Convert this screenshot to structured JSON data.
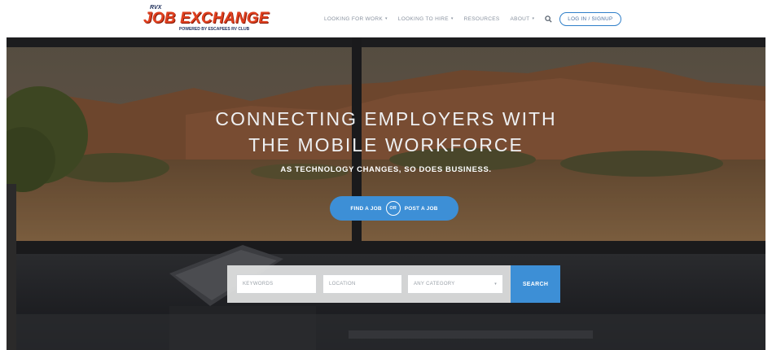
{
  "header": {
    "logo": {
      "top_mark": "RVX",
      "brand": "JOB EXCHANGE",
      "powered_by": "POWERED BY ESCAPEES RV CLUB"
    },
    "nav": [
      {
        "label": "LOOKING FOR WORK",
        "has_dropdown": true
      },
      {
        "label": "LOOKING TO HIRE",
        "has_dropdown": true
      },
      {
        "label": "RESOURCES",
        "has_dropdown": false
      },
      {
        "label": "ABOUT",
        "has_dropdown": true
      }
    ],
    "search_icon": "search-icon",
    "login_label": "LOG IN / SIGNUP"
  },
  "hero": {
    "headline_line1": "CONNECTING EMPLOYERS WITH",
    "headline_line2": "THE MOBILE WORKFORCE",
    "subhead": "AS TECHNOLOGY CHANGES, SO DOES BUSINESS.",
    "cta": {
      "find_label": "FIND A JOB",
      "or_label": "OR",
      "post_label": "POST A JOB"
    }
  },
  "search": {
    "keywords_placeholder": "KEYWORDS",
    "location_placeholder": "LOCATION",
    "category_value": "ANY CATEGORY",
    "button_label": "SEARCH"
  },
  "colors": {
    "brand_red": "#e0401f",
    "accent_blue": "#3d8fd6",
    "nav_text": "#8a93a0"
  }
}
